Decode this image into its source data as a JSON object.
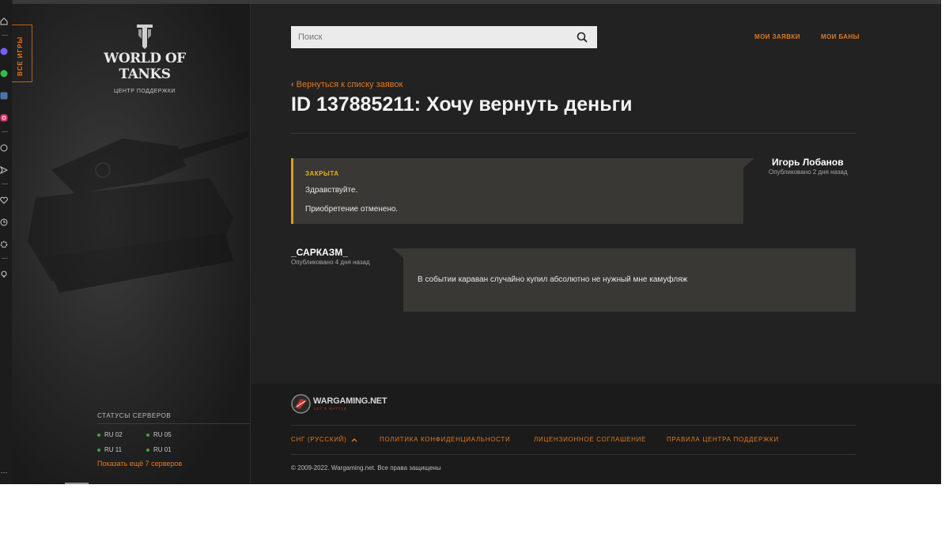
{
  "browser_sidebar": {
    "icons": [
      "home-icon",
      "messenger-icon",
      "whatsapp-icon",
      "vk-icon",
      "instagram-icon",
      "chat-icon",
      "send-icon",
      "heart-icon",
      "clock-icon",
      "settings-icon",
      "bulb-icon",
      "more-icon"
    ]
  },
  "left_panel": {
    "all_games_label": "ВСЕ ИГРЫ",
    "logo_text": "WORLD OF TANKS",
    "logo_subtitle": "ЦЕНТР ПОДДЕРЖКИ",
    "server_status_title": "СТАТУСЫ СЕРВЕРОВ",
    "servers": [
      "RU 02",
      "RU 05",
      "RU 11",
      "RU 01"
    ],
    "show_more": "Показать ещё 7 серверов"
  },
  "header": {
    "search_placeholder": "Поиск",
    "my_requests": "МОИ ЗАЯВКИ",
    "my_bans": "МОИ БАНЫ"
  },
  "ticket": {
    "back_link": "Вернуться к списку заявок",
    "title": "ID 137885211: Хочу вернуть деньги",
    "messages": [
      {
        "status": "ЗАКРЫТА",
        "lines": [
          "Здравствуйте.",
          "Приобретение отменено."
        ],
        "author": "Игорь Лобанов",
        "date": "Опубликовано 2 дня назад"
      },
      {
        "lines": [
          "В событии караван случайно купил абсолютно не нужный мне камуфляж"
        ],
        "author": "_САРКАЗМ_",
        "date": "Опубликовано 4 дня назад"
      }
    ]
  },
  "footer": {
    "brand": "WARGAMING.NET",
    "brand_tagline": "LET'S BATTLE",
    "links": [
      "СНГ (РУССКИЙ)",
      "ПОЛИТИКА КОНФИДЕНЦИАЛЬНОСТИ",
      "ЛИЦЕНЗИОННОЕ СОГЛАШЕНИЕ",
      "ПРАВИЛА ЦЕНТРА ПОДДЕРЖКИ"
    ],
    "copyright": "© 2009-2022. Wargaming.net. Все права защищены"
  },
  "colors": {
    "accent": "#e07a22",
    "status_closed": "#e8b21a",
    "server_online": "#3aa63a",
    "page_bg": "#222222",
    "message_bg": "#3a3835"
  }
}
